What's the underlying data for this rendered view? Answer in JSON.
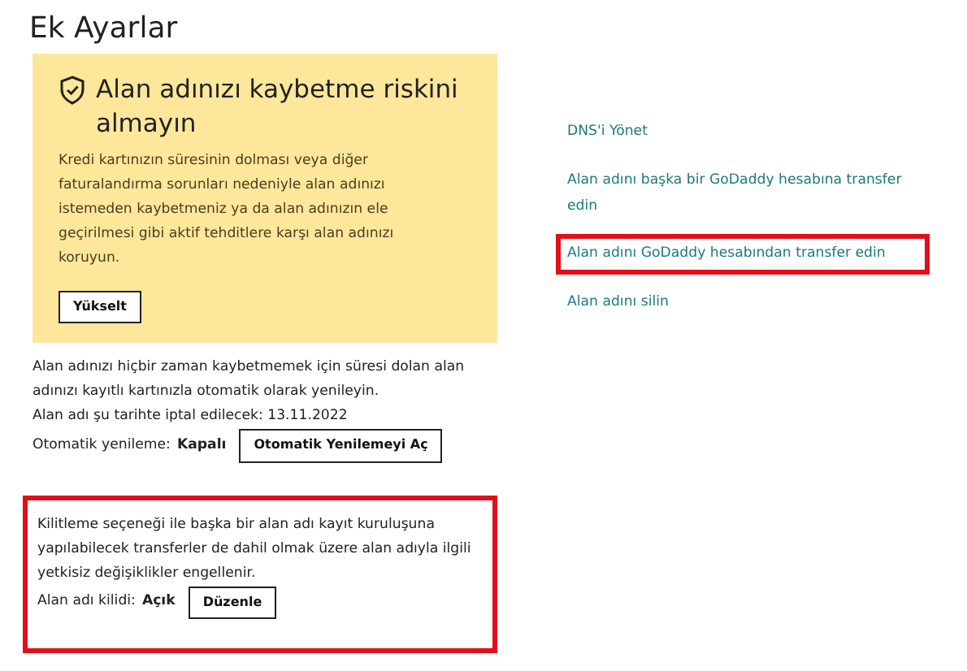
{
  "title": "Ek Ayarlar",
  "promo": {
    "heading": "Alan adınızı kaybetme riskini almayın",
    "body": "Kredi kartınızın süresinin dolması veya diğer faturalandırma sorunları nedeniyle alan adınızı istemeden kaybetmeniz ya da alan adınızın ele geçirilmesi gibi aktif tehditlere karşı alan adınızı koruyun.",
    "button": "Yükselt"
  },
  "renewal": {
    "description": "Alan adınızı hiçbir zaman kaybetmemek için süresi dolan alan adınızı kayıtlı kartınızla otomatik olarak yenileyin.",
    "cancel_date": "Alan adı şu tarihte iptal edilecek: 13.11.2022",
    "status_label": "Otomatik yenileme:",
    "status_value": "Kapalı",
    "button": "Otomatik Yenilemeyi Aç"
  },
  "lock": {
    "highlighted": true,
    "description": "Kilitleme seçeneği ile başka bir alan adı kayıt kuruluşuna yapılabilecek transferler de dahil olmak üzere alan adıyla ilgili yetkisiz değişiklikler engellenir.",
    "status_label": "Alan adı kilidi:",
    "status_value": "Açık",
    "button": "Düzenle"
  },
  "links": [
    {
      "label": "DNS'i Yönet",
      "highlighted": false
    },
    {
      "label": "Alan adını başka bir GoDaddy hesabına transfer edin",
      "highlighted": false
    },
    {
      "label": "Alan adını GoDaddy hesabından transfer edin",
      "highlighted": true
    },
    {
      "label": "Alan adını silin",
      "highlighted": false
    }
  ]
}
